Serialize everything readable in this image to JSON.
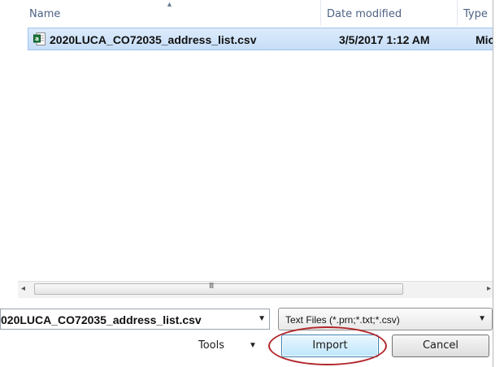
{
  "columns": {
    "name": "Name",
    "date_modified": "Date modified",
    "type": "Type"
  },
  "files": [
    {
      "name": "2020LUCA_CO72035_address_list.csv",
      "date_modified": "3/5/2017 1:12 AM",
      "type": "Micro",
      "icon": "csv-file-icon",
      "selected": true
    }
  ],
  "scrollbar": {
    "grip": "III"
  },
  "file_name_field": {
    "value": "020LUCA_CO72035_address_list.csv"
  },
  "filter": {
    "selected": "Text Files (*.prn;*.txt;*.csv)"
  },
  "buttons": {
    "tools": "Tools",
    "import": "Import",
    "cancel": "Cancel"
  },
  "annotation": {
    "highlight_color": "#b2262a",
    "highlights": "import-button"
  },
  "colors": {
    "selection_bg": "#cde2f9",
    "header_text": "#4d6185"
  }
}
